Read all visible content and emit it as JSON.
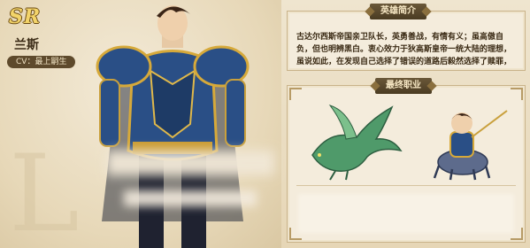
{
  "hero": {
    "rarity": "SR",
    "name": "兰斯",
    "cv": "CV：最上嗣生",
    "big_letter": "L"
  },
  "profile": {
    "title": "英雄简介",
    "text": "古达尔西斯帝国亲卫队长，英勇善战，有情有义；虽高傲自负，但也明辨黑白。衷心效力于狄高斯皇帝一统大陆的理想，虽说如此，在发现自己选择了错误的道路后毅然选择了赎罪，甚"
  },
  "final_class": {
    "title": "最终职业"
  },
  "colors": {
    "armor_blue": "#2a4f86",
    "gold": "#d6a93a",
    "dragon_green": "#4f9a6a",
    "plaque": "#5b4a2e"
  }
}
